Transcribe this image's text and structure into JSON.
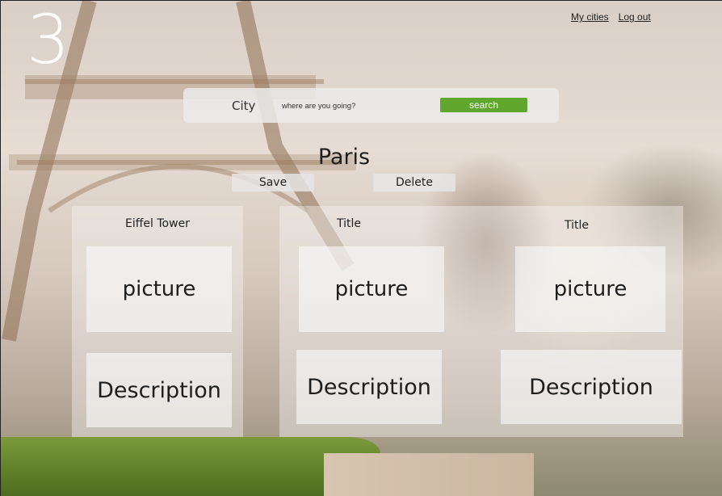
{
  "brand": {
    "logo": "3"
  },
  "nav": {
    "my_cities": "My cities",
    "log_out": "Log out"
  },
  "search": {
    "label": "City",
    "placeholder": "where are you going?",
    "button": "search",
    "button_color": "#5fa82d"
  },
  "city": {
    "name": "Paris",
    "save_label": "Save",
    "delete_label": "Delete"
  },
  "places": [
    {
      "title": "Eiffel Tower",
      "picture": "picture",
      "description": "Description"
    },
    {
      "title": "Title",
      "picture": "picture",
      "description": "Description"
    },
    {
      "title": "Title",
      "picture": "picture",
      "description": "Description"
    }
  ]
}
